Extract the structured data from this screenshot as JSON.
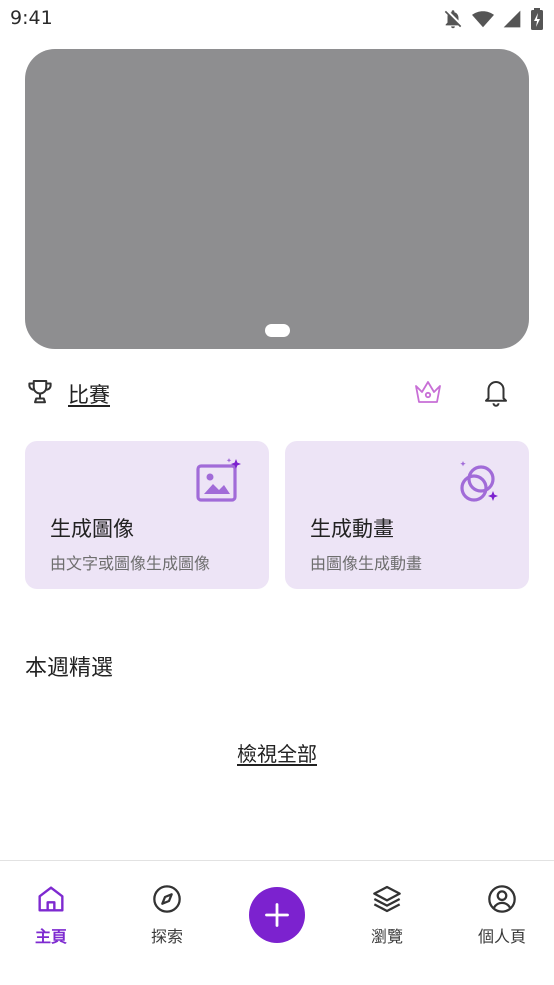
{
  "status_bar": {
    "time": "9:41"
  },
  "banner": {
    "slide_indicator": "1"
  },
  "contest": {
    "label": "比賽"
  },
  "cards": [
    {
      "title": "生成圖像",
      "subtitle": "由文字或圖像生成圖像",
      "icon": "image-sparkle-icon"
    },
    {
      "title": "生成動畫",
      "subtitle": "由圖像生成動畫",
      "icon": "animation-sparkle-icon"
    }
  ],
  "featured": {
    "title": "本週精選",
    "view_all": "檢視全部"
  },
  "nav": [
    {
      "label": "主頁",
      "icon": "home-icon",
      "active": true
    },
    {
      "label": "探索",
      "icon": "compass-icon",
      "active": false
    },
    {
      "label": "",
      "icon": "plus-icon",
      "active": false
    },
    {
      "label": "瀏覽",
      "icon": "layers-icon",
      "active": false
    },
    {
      "label": "個人頁",
      "icon": "profile-icon",
      "active": false
    }
  ],
  "colors": {
    "accent": "#7c22cf",
    "card_bg": "#ede4f6",
    "banner_placeholder": "#8e8e90",
    "crown": "#c86fd6"
  }
}
